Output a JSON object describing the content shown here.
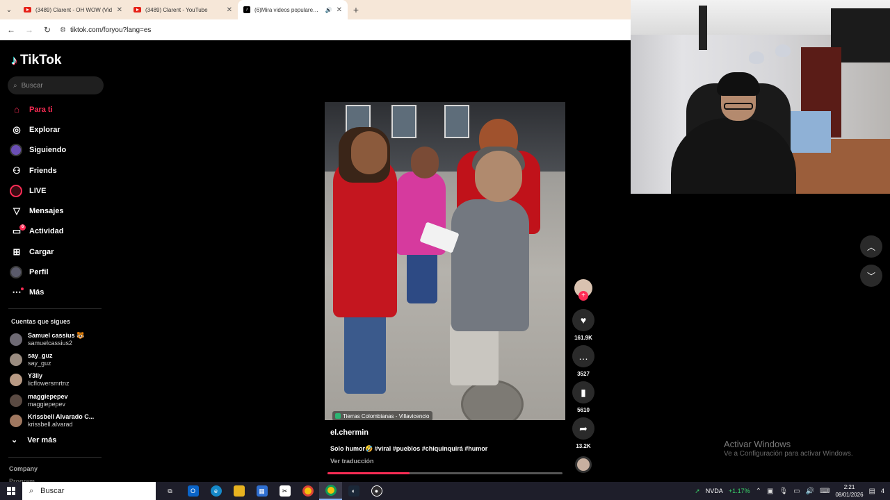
{
  "browser": {
    "tabs": [
      {
        "title": "(3489) Clarent - OH WOW (Vid",
        "icon": "youtube-icon"
      },
      {
        "title": "(3489) Clarent - YouTube",
        "icon": "youtube-icon"
      },
      {
        "title": "(6)Mira videos populares se",
        "icon": "tiktok-icon",
        "active": true
      }
    ],
    "url": "tiktok.com/foryou?lang=es"
  },
  "sidebar": {
    "logo": "TikTok",
    "search_placeholder": "Buscar",
    "nav": [
      {
        "label": "Para ti",
        "icon": "home-icon",
        "active": true
      },
      {
        "label": "Explorar",
        "icon": "compass-icon"
      },
      {
        "label": "Siguiendo",
        "icon": "following-avatar-icon"
      },
      {
        "label": "Friends",
        "icon": "friends-icon"
      },
      {
        "label": "LIVE",
        "icon": "live-icon"
      },
      {
        "label": "Mensajes",
        "icon": "messages-icon"
      },
      {
        "label": "Actividad",
        "icon": "activity-icon",
        "badge": "6"
      },
      {
        "label": "Cargar",
        "icon": "upload-icon"
      },
      {
        "label": "Perfil",
        "icon": "profile-avatar-icon"
      },
      {
        "label": "Más",
        "icon": "more-icon"
      }
    ],
    "following_title": "Cuentas que sigues",
    "following": [
      {
        "name": "Samuel cassius 🐯",
        "user": "samuelcassius2"
      },
      {
        "name": "say_guz",
        "user": "say_guz"
      },
      {
        "name": "Y3lly",
        "user": "licflowersmrtnz"
      },
      {
        "name": "maggiepepev",
        "user": "maggiepepev"
      },
      {
        "name": "Krissbell Alvarado C...",
        "user": "krissbell.alvarad"
      }
    ],
    "see_more": "Ver más",
    "company": "Company",
    "program": "Program"
  },
  "video": {
    "location": "Tierras Colombianas - Villavicencio",
    "author": "el.chermin",
    "caption": "Solo humor🤣 #viral #pueblos #chiquinquirá #humor",
    "translate": "Ver traducción",
    "progress": 0.35
  },
  "actions": {
    "likes": "161.9K",
    "comments": "3527",
    "saves": "5610",
    "shares": "13.2K"
  },
  "windows_watermark": {
    "title": "Activar Windows",
    "subtitle": "Ve a Configuración para activar Windows."
  },
  "taskbar": {
    "search": "Buscar",
    "stock_name": "NVDA",
    "stock_change": "+1.17%",
    "time": "2:21",
    "date": "08/01/2026",
    "notifications": "4"
  },
  "colors": {
    "accent": "#fe2c55",
    "tab_bar": "#f6e7d8"
  }
}
